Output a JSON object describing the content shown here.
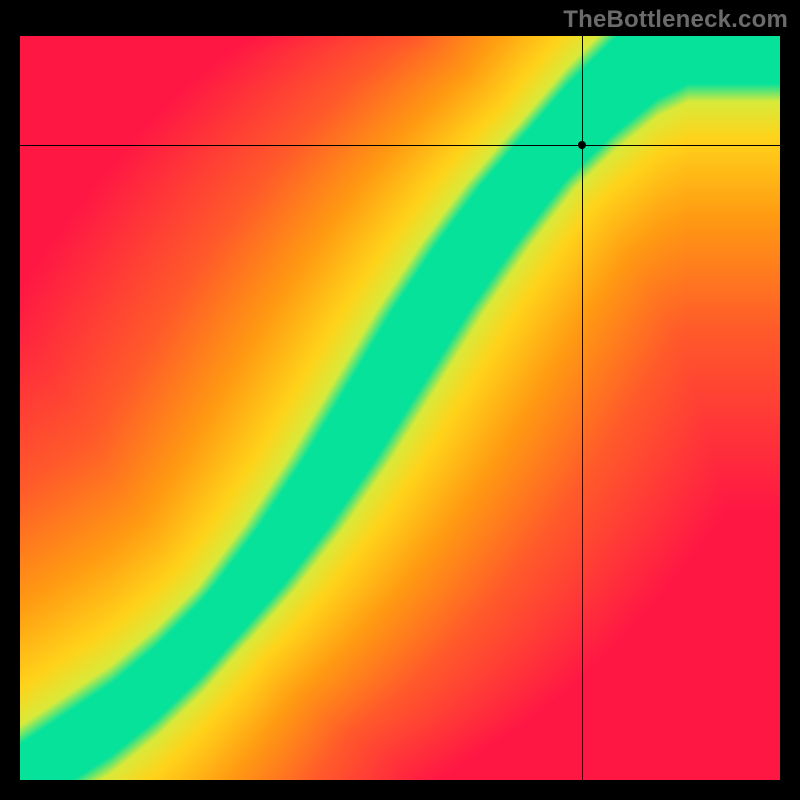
{
  "watermark": "TheBottleneck.com",
  "chart_data": {
    "type": "heatmap",
    "title": "",
    "xlabel": "",
    "ylabel": "",
    "xlim": [
      0,
      1
    ],
    "ylim": [
      0,
      1
    ],
    "crosshair": {
      "x": 0.74,
      "y": 0.854
    },
    "optimal_curve": {
      "description": "Green band centre curve (x vs y fraction of plot, origin bottom-left). Band is ~0.05 wide near bottom, ~0.12 wide near top.",
      "points": [
        [
          0.0,
          0.0
        ],
        [
          0.06,
          0.04
        ],
        [
          0.12,
          0.08
        ],
        [
          0.18,
          0.13
        ],
        [
          0.24,
          0.19
        ],
        [
          0.3,
          0.26
        ],
        [
          0.36,
          0.34
        ],
        [
          0.42,
          0.43
        ],
        [
          0.48,
          0.53
        ],
        [
          0.54,
          0.63
        ],
        [
          0.6,
          0.72
        ],
        [
          0.66,
          0.8
        ],
        [
          0.72,
          0.87
        ],
        [
          0.78,
          0.93
        ],
        [
          0.84,
          0.98
        ],
        [
          0.88,
          1.0
        ]
      ]
    },
    "color_scale": {
      "description": "Distance from optimal curve → colour",
      "stops": [
        {
          "d": 0.0,
          "color": "#07e29b"
        },
        {
          "d": 0.06,
          "color": "#07e29b"
        },
        {
          "d": 0.1,
          "color": "#d9ea3a"
        },
        {
          "d": 0.18,
          "color": "#ffd31a"
        },
        {
          "d": 0.35,
          "color": "#ff9b12"
        },
        {
          "d": 0.6,
          "color": "#ff5a2a"
        },
        {
          "d": 1.0,
          "color": "#ff1744"
        }
      ]
    },
    "corner_hint": {
      "top_left": "#ff1744",
      "top_right": "#ffe02a",
      "bottom_left": "#ff1744",
      "bottom_right": "#ff1744"
    }
  }
}
